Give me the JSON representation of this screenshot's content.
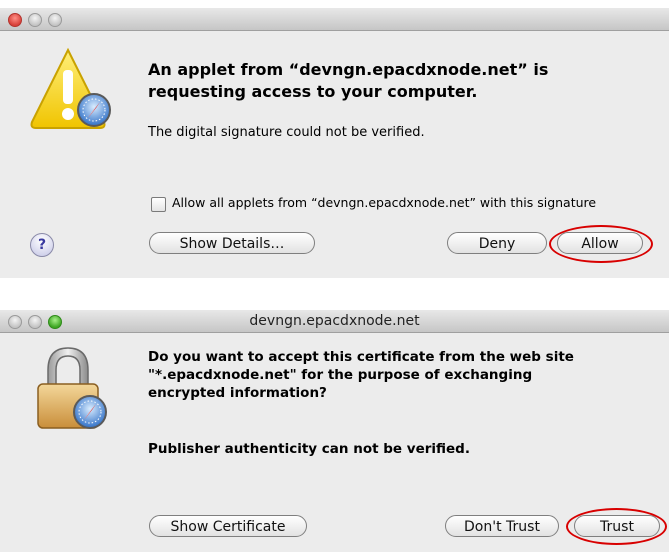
{
  "applet_dialog": {
    "headline": "An applet from “devngn.epacdxnode.net” is requesting access to your computer.",
    "message": "The digital signature could not be verified.",
    "checkbox_label": "Allow all applets from “devngn.epacdxnode.net” with this signature",
    "checkbox_checked": false,
    "help_glyph": "?",
    "show_details_label": "Show Details…",
    "deny_label": "Deny",
    "allow_label": "Allow",
    "icon": "warning-icon"
  },
  "cert_dialog": {
    "window_title": "devngn.epacdxnode.net",
    "question": "Do you want to accept this certificate from the web site \"*.epacdxnode.net\" for the purpose of exchanging encrypted information?",
    "publisher_note": "Publisher authenticity can not be verified.",
    "show_certificate_label": "Show Certificate",
    "dont_trust_label": "Don't Trust",
    "trust_label": "Trust",
    "icon": "lock-icon"
  },
  "colors": {
    "annotation_red": "#d80000",
    "dialog_bg": "#ececec"
  }
}
